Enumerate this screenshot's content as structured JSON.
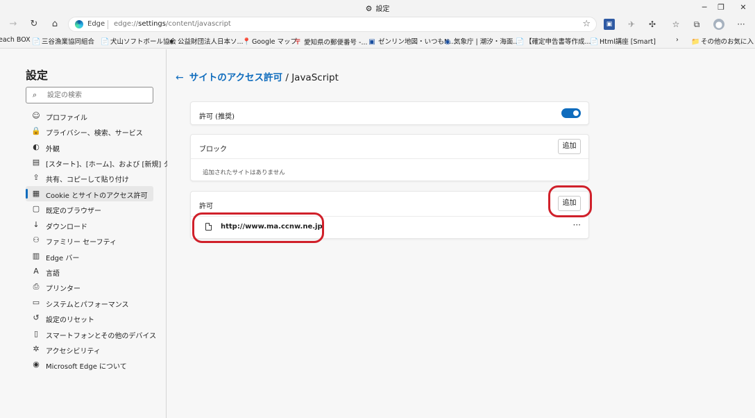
{
  "window": {
    "title": "設定",
    "gear_icon": "⚙"
  },
  "window_controls": {
    "minimize": "─",
    "restore": "❐",
    "close": "✕"
  },
  "address_bar": {
    "badge": "Edge",
    "url_prefix": "edge://",
    "url_main": "settings",
    "url_suffix": "/content/javascript"
  },
  "favorites": [
    {
      "label": "each BOX",
      "icon": ""
    },
    {
      "label": "三谷漁業協同組合",
      "icon": "📄"
    },
    {
      "label": "犬山ソフトボール協会",
      "icon": "📄"
    },
    {
      "label": "公益財団法人日本ソ...",
      "icon": "★"
    },
    {
      "label": "Google マップ",
      "icon": "📍"
    },
    {
      "label": "愛知県の郵便番号 -...",
      "icon": "〒"
    },
    {
      "label": "ゼンリン地図・いつもN...",
      "icon": "▣"
    },
    {
      "label": "気象庁 | 潮汐・海面...",
      "icon": "◉"
    },
    {
      "label": "【確定申告書等作成...",
      "icon": "📄"
    },
    {
      "label": "Html講座 [Smart]",
      "icon": "📄"
    },
    {
      "label": "その他のお気に入り",
      "icon": "📁"
    }
  ],
  "sidebar": {
    "title": "設定",
    "search_placeholder": "設定の検索",
    "items": [
      {
        "label": "プロファイル",
        "icon": "☺"
      },
      {
        "label": "プライバシー、検索、サービス",
        "icon": "🔒"
      },
      {
        "label": "外観",
        "icon": "◐"
      },
      {
        "label": "[スタート]、[ホーム]、および [新規] タブ",
        "icon": "▤"
      },
      {
        "label": "共有、コピーして貼り付け",
        "icon": "⇪"
      },
      {
        "label": "Cookie とサイトのアクセス許可",
        "icon": "▦"
      },
      {
        "label": "既定のブラウザー",
        "icon": "▢"
      },
      {
        "label": "ダウンロード",
        "icon": "↓"
      },
      {
        "label": "ファミリー セーフティ",
        "icon": "⚇"
      },
      {
        "label": "Edge バー",
        "icon": "▥"
      },
      {
        "label": "言語",
        "icon": "A"
      },
      {
        "label": "プリンター",
        "icon": "⎙"
      },
      {
        "label": "システムとパフォーマンス",
        "icon": "▭"
      },
      {
        "label": "設定のリセット",
        "icon": "↺"
      },
      {
        "label": "スマートフォンとその他のデバイス",
        "icon": "▯"
      },
      {
        "label": "アクセシビリティ",
        "icon": "✲"
      },
      {
        "label": "Microsoft Edge について",
        "icon": "◉"
      }
    ]
  },
  "main": {
    "breadcrumb_link": "サイトのアクセス許可",
    "breadcrumb_rest": " / JavaScript",
    "allowed_recommended": "許可 (推奨)",
    "block_title": "ブロック",
    "block_add": "追加",
    "block_empty": "追加されたサイトはありません",
    "allow_title": "許可",
    "allow_add": "追加",
    "allowed_site": "http://www.ma.ccnw.ne.jp",
    "more_label": "···"
  }
}
